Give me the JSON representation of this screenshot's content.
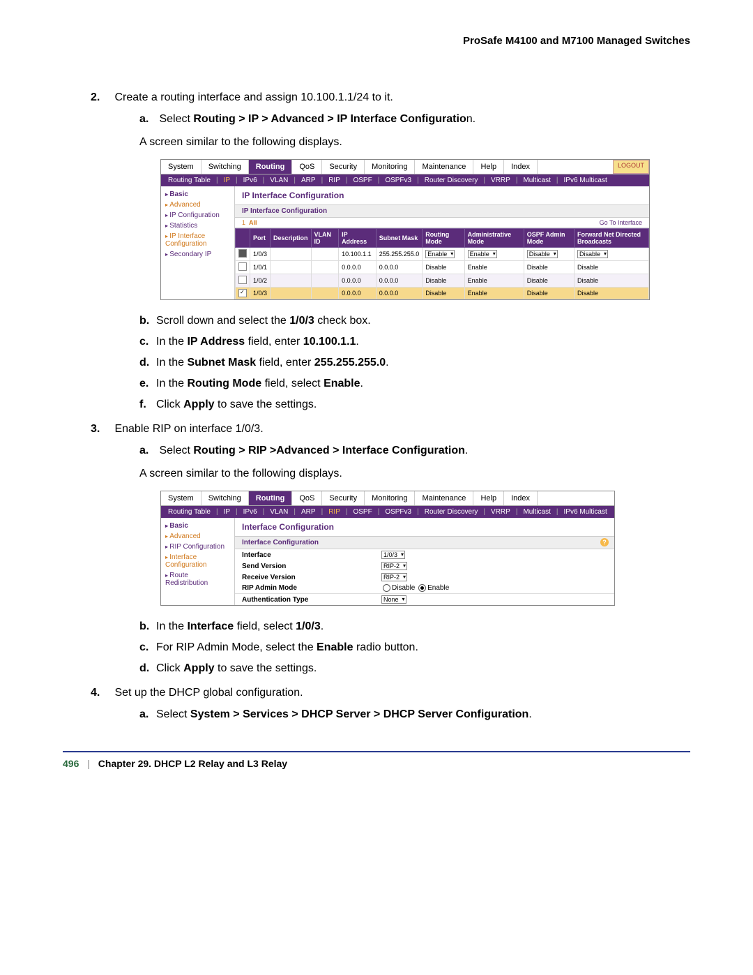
{
  "header": "ProSafe M4100 and M7100 Managed Switches",
  "steps": {
    "s2": {
      "num": "2.",
      "txt": "Create a routing interface and assign 10.100.1.1/24 to it.",
      "a_pre": "Select ",
      "a_bold": "Routing > IP > Advanced > IP Interface Configuratio",
      "a_post": "n.",
      "screen_txt": "A screen similar to the following displays.",
      "b": {
        "pre": "Scroll down and select the ",
        "bold": "1/0/3",
        "post": " check box."
      },
      "c": {
        "pre": "In the ",
        "bold": "IP Address",
        "mid": " field, enter ",
        "bold2": "10.100.1.1",
        "post": "."
      },
      "d": {
        "pre": "In the ",
        "bold": "Subnet Mask",
        "mid": " field, enter ",
        "bold2": "255.255.255.0",
        "post": "."
      },
      "e": {
        "pre": "In the ",
        "bold": "Routing Mode",
        "mid": " field, select ",
        "bold2": "Enable",
        "post": "."
      },
      "f": {
        "pre": "Click ",
        "bold": "Apply",
        "post": " to save the settings."
      }
    },
    "s3": {
      "num": "3.",
      "txt": "Enable RIP on interface 1/0/3.",
      "a_pre": "Select ",
      "a_bold": "Routing > RIP >Advanced > Interface Configuration",
      "a_post": ".",
      "screen_txt": "A screen similar to the following displays.",
      "b": {
        "pre": "In the ",
        "bold": "Interface",
        "mid": " field, select ",
        "bold2": "1/0/3",
        "post": "."
      },
      "c": {
        "pre": "For RIP Admin Mode, select the ",
        "bold": "Enable",
        "post": " radio button."
      },
      "d": {
        "pre": "Click ",
        "bold": "Apply",
        "post": " to save the settings."
      }
    },
    "s4": {
      "num": "4.",
      "txt": "Set up the DHCP global configuration.",
      "a_pre": "Select ",
      "a_bold": "System > Services > DHCP Server > DHCP Server Configuration",
      "a_post": "."
    }
  },
  "shot1": {
    "tabs": [
      "System",
      "Switching",
      "Routing",
      "QoS",
      "Security",
      "Monitoring",
      "Maintenance",
      "Help",
      "Index"
    ],
    "logout": "LOGOUT",
    "subtabs": [
      "Routing Table",
      "IP",
      "IPv6",
      "VLAN",
      "ARP",
      "RIP",
      "OSPF",
      "OSPFv3",
      "Router Discovery",
      "VRRP",
      "Multicast",
      "IPv6 Multicast"
    ],
    "active_sub": "IP",
    "side": [
      "Basic",
      "Advanced",
      "IP Configuration",
      "Statistics",
      "IP Interface Configuration",
      "Secondary IP"
    ],
    "title": "IP Interface Configuration",
    "subtitle": "IP Interface Configuration",
    "all": "All",
    "goto": "Go To Interface",
    "cols": [
      "",
      "Port",
      "Description",
      "VLAN ID",
      "IP Address",
      "Subnet Mask",
      "Routing Mode",
      "Administrative Mode",
      "OSPF Admin Mode",
      "Forward Net Directed Broadcasts"
    ],
    "rows": [
      {
        "cb": "dark",
        "port": "1/0/3",
        "desc": "",
        "vlan": "",
        "ip": "10.100.1.1",
        "mask": "255.255.255.0",
        "rmode": "Enable",
        "amode": "Enable",
        "ospf": "Disable",
        "fwd": "Disable",
        "dd": true,
        "cls": ""
      },
      {
        "cb": "",
        "port": "1/0/1",
        "desc": "",
        "vlan": "",
        "ip": "0.0.0.0",
        "mask": "0.0.0.0",
        "rmode": "Disable",
        "amode": "Enable",
        "ospf": "Disable",
        "fwd": "Disable",
        "dd": false,
        "cls": ""
      },
      {
        "cb": "",
        "port": "1/0/2",
        "desc": "",
        "vlan": "",
        "ip": "0.0.0.0",
        "mask": "0.0.0.0",
        "rmode": "Disable",
        "amode": "Enable",
        "ospf": "Disable",
        "fwd": "Disable",
        "dd": false,
        "cls": "alt"
      },
      {
        "cb": "chk",
        "port": "1/0/3",
        "desc": "",
        "vlan": "",
        "ip": "0.0.0.0",
        "mask": "0.0.0.0",
        "rmode": "Disable",
        "amode": "Enable",
        "ospf": "Disable",
        "fwd": "Disable",
        "dd": false,
        "cls": "sel"
      }
    ]
  },
  "shot2": {
    "tabs": [
      "System",
      "Switching",
      "Routing",
      "QoS",
      "Security",
      "Monitoring",
      "Maintenance",
      "Help",
      "Index"
    ],
    "subtabs": [
      "Routing Table",
      "IP",
      "IPv6",
      "VLAN",
      "ARP",
      "RIP",
      "OSPF",
      "OSPFv3",
      "Router Discovery",
      "VRRP",
      "Multicast",
      "IPv6 Multicast"
    ],
    "active_sub": "RIP",
    "side": [
      "Basic",
      "Advanced",
      "RIP Configuration",
      "Interface Configuration",
      "Route Redistribution"
    ],
    "title": "Interface Configuration",
    "subtitle": "Interface Configuration",
    "fields": {
      "interface": {
        "lbl": "Interface",
        "val": "1/0/3"
      },
      "send": {
        "lbl": "Send Version",
        "val": "RIP-2"
      },
      "recv": {
        "lbl": "Receive Version",
        "val": "RIP-2"
      },
      "admin": {
        "lbl": "RIP Admin Mode",
        "opt1": "Disable",
        "opt2": "Enable"
      },
      "auth": {
        "lbl": "Authentication Type",
        "val": "None"
      }
    }
  },
  "footer": {
    "page": "496",
    "chapter": "Chapter 29.  DHCP L2 Relay and L3 Relay"
  }
}
